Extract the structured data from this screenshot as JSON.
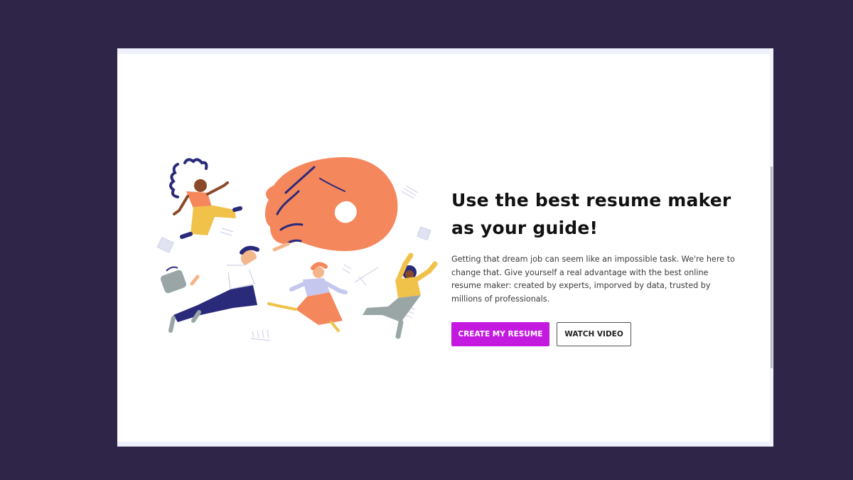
{
  "hero": {
    "headline": "Use the best resume maker as your guide!",
    "description": "Getting that dream job can seem like an impossible task. We're here to change that. Give yourself a real advantage with the best online resume maker: created by experts, imporved by data, trusted by millions of professionals.",
    "primary_button": "CREATE MY RESUME",
    "secondary_button": "WATCH VIDEO"
  },
  "colors": {
    "background": "#2f2549",
    "primary_button": "#c41ae0",
    "hand": "#f5875d",
    "navy": "#2a2a7a",
    "mustard": "#f0c24a"
  },
  "icons": [
    "hand-illustration",
    "curly-hair-woman-illustration",
    "running-man-illustration",
    "running-woman-illustration",
    "waving-woman-illustration",
    "briefcase-illustration"
  ]
}
